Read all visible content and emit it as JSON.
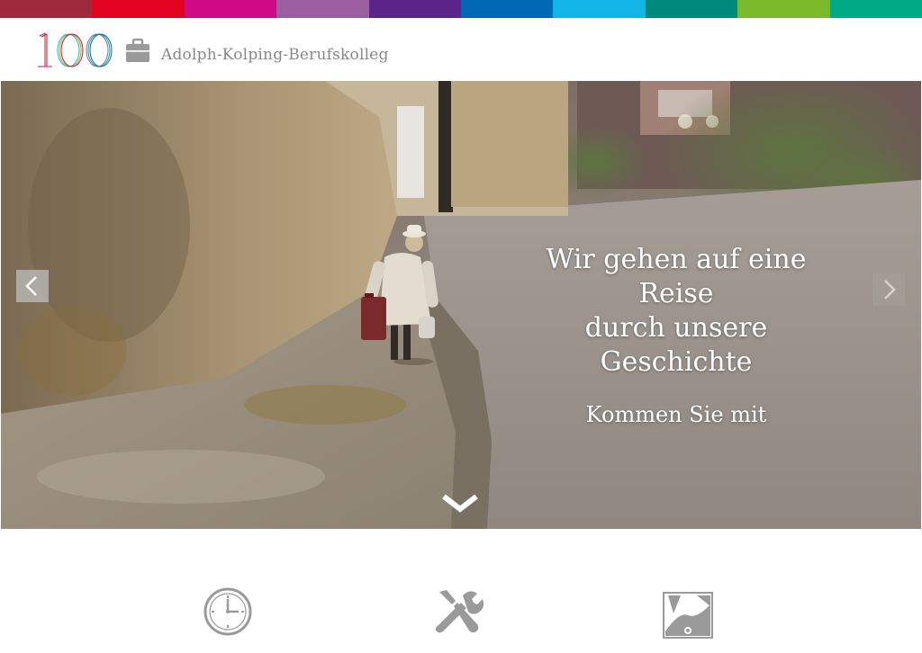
{
  "colors": {
    "colorbar": [
      "#9e2a3c",
      "#e30421",
      "#cf0a86",
      "#9b5fa1",
      "#5b2489",
      "#0068b4",
      "#13b4e7",
      "#008a7b",
      "#7ab929",
      "#00a886"
    ],
    "icon_gray": "#9a9a9a"
  },
  "header": {
    "logo_text": "100",
    "logo_icon": "suitcase-icon",
    "site_title": "Adolph-Kolping-Berufskolleg"
  },
  "hero": {
    "headline_line1": "Wir gehen auf eine Reise",
    "headline_line2": "durch unsere Geschichte",
    "subline": "Kommen Sie mit",
    "prev_icon": "chevron-left-icon",
    "next_icon": "chevron-right-icon",
    "scroll_icon": "chevron-down-icon"
  },
  "features": {
    "items": [
      {
        "icon": "clock-icon"
      },
      {
        "icon": "tools-icon"
      },
      {
        "icon": "photo-icon"
      }
    ]
  }
}
